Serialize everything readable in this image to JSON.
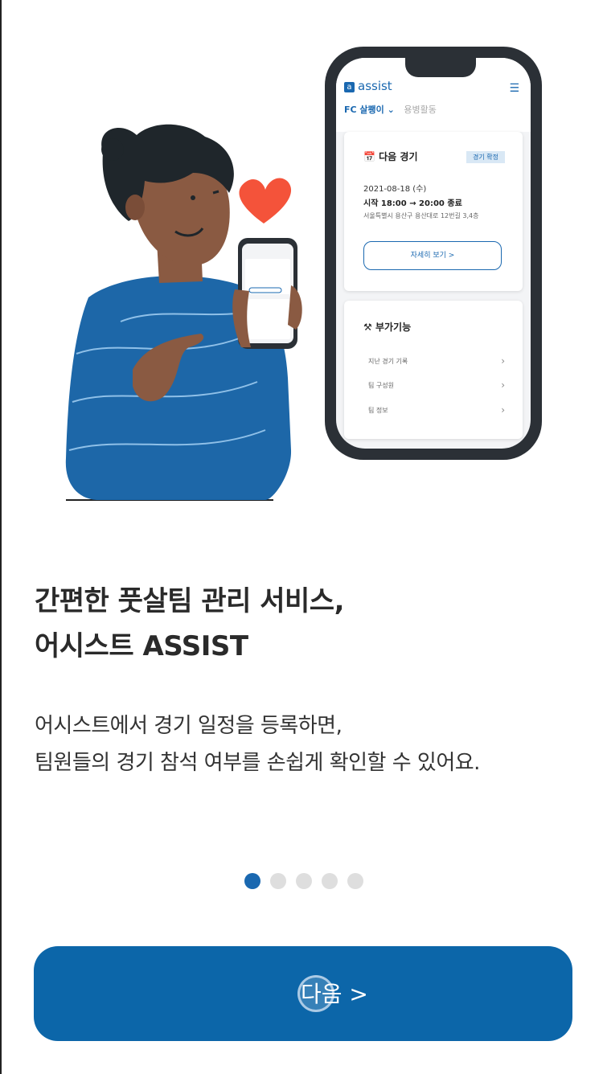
{
  "illustration": {
    "app_logo": "assist",
    "team_name": "FC 살쾡이",
    "team_sub": "용병활동",
    "next_match": {
      "title": "다음 경기",
      "badge": "경기 확정",
      "date": "2021-08-18 (수)",
      "time": "시작 18:00 → 20:00 종료",
      "address": "서울특별시 용산구 용산대로 12번길 3,4층",
      "details_button": "자세히 보기 >"
    },
    "extras": {
      "title": "부가기능",
      "items": [
        "지난 경기 기록",
        "팀 구성원",
        "팀 정보"
      ]
    }
  },
  "heading": {
    "line1": "간편한 풋살팀 관리 서비스,",
    "line2": "어시스트 ASSIST"
  },
  "description": {
    "line1": "어시스트에서 경기 일정을 등록하면,",
    "line2": "팀원들의 경기 참석 여부를 손쉽게 확인할 수 있어요."
  },
  "pagination": {
    "total": 5,
    "current": 1
  },
  "next_button": {
    "label": "다음 >"
  },
  "colors": {
    "primary": "#0c66a9",
    "dot_inactive": "#dedede",
    "shirt": "#1d67a8",
    "heart": "#f4533a"
  }
}
